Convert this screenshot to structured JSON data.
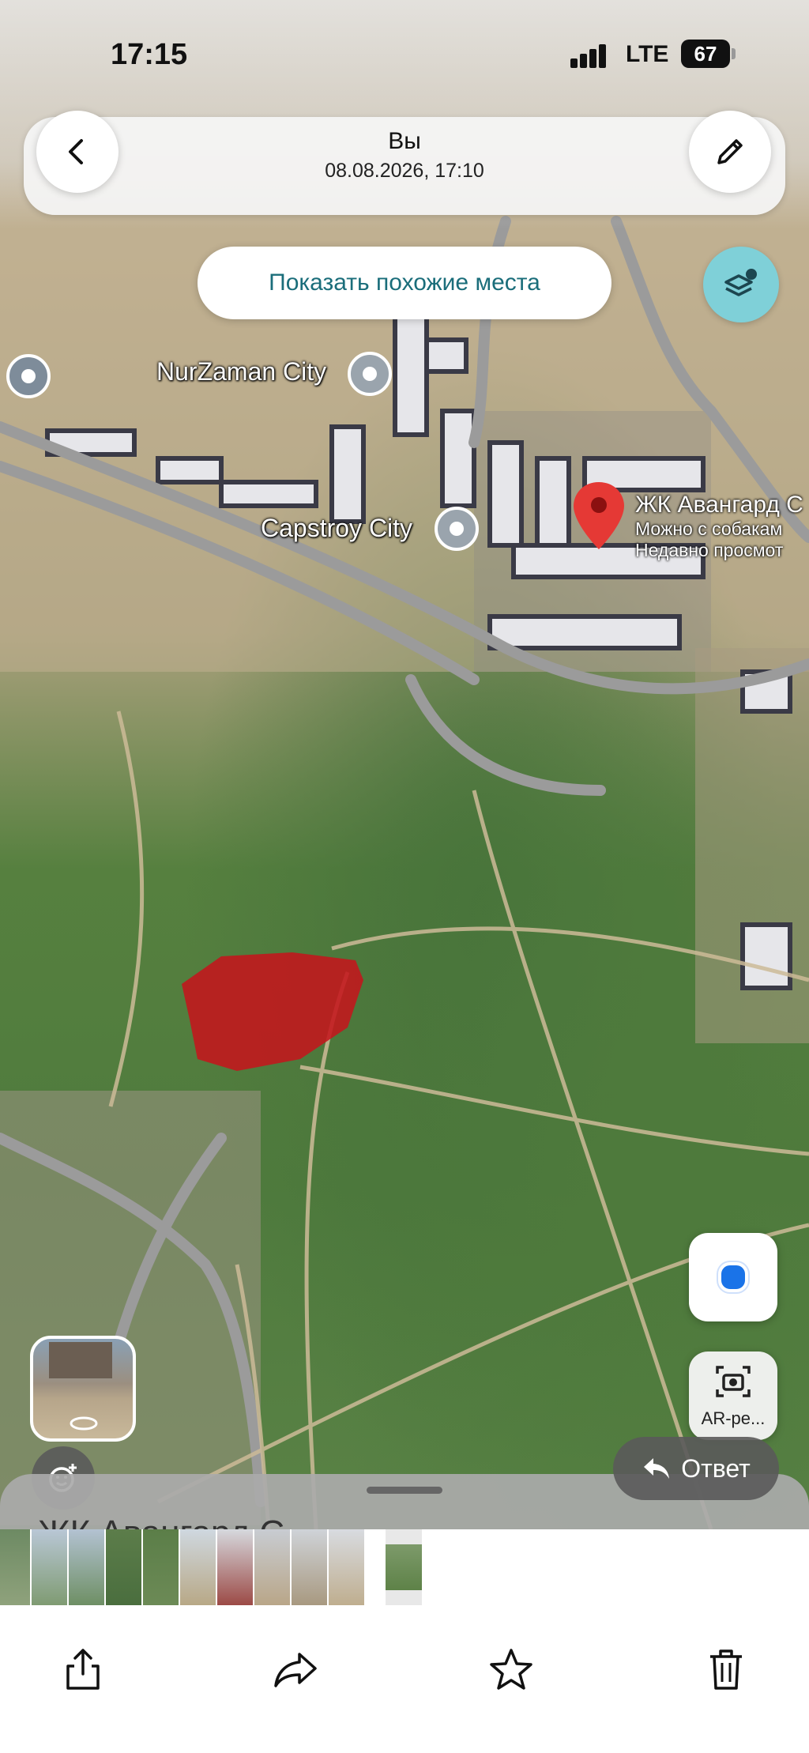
{
  "status_bar": {
    "time": "17:15",
    "network": "LTE",
    "battery": "67"
  },
  "top_bar": {
    "title": "Вы",
    "subtitle": "08.08.2026, 17:10"
  },
  "similar_places_button": "Показать похожие места",
  "map_labels": {
    "nurzaman": "NurZaman City",
    "capstroy": "Capstroy City",
    "avangard_title": "ЖК Авангард С",
    "avangard_line2": "Можно с собакам",
    "avangard_line3": "Недавно просмот"
  },
  "ar_button": "AR-ре...",
  "reply_button": "Ответ",
  "bottom_sheet_peek": "ЖК Авангард С",
  "colors": {
    "accent": "#1a6d7a",
    "pin_red": "#e53935",
    "location_blue": "#1a73e8",
    "highlight_area": "#c4161c"
  },
  "icons": {
    "back": "chevron-left-icon",
    "edit": "pencil-icon",
    "layers": "layers-icon",
    "my_location": "location-dot-icon",
    "ar": "camera-icon",
    "reply": "reply-arrow-icon",
    "emoji": "add-reaction-icon",
    "share": "share-icon",
    "forward": "forward-icon",
    "favorite": "star-icon",
    "delete": "trash-icon"
  }
}
